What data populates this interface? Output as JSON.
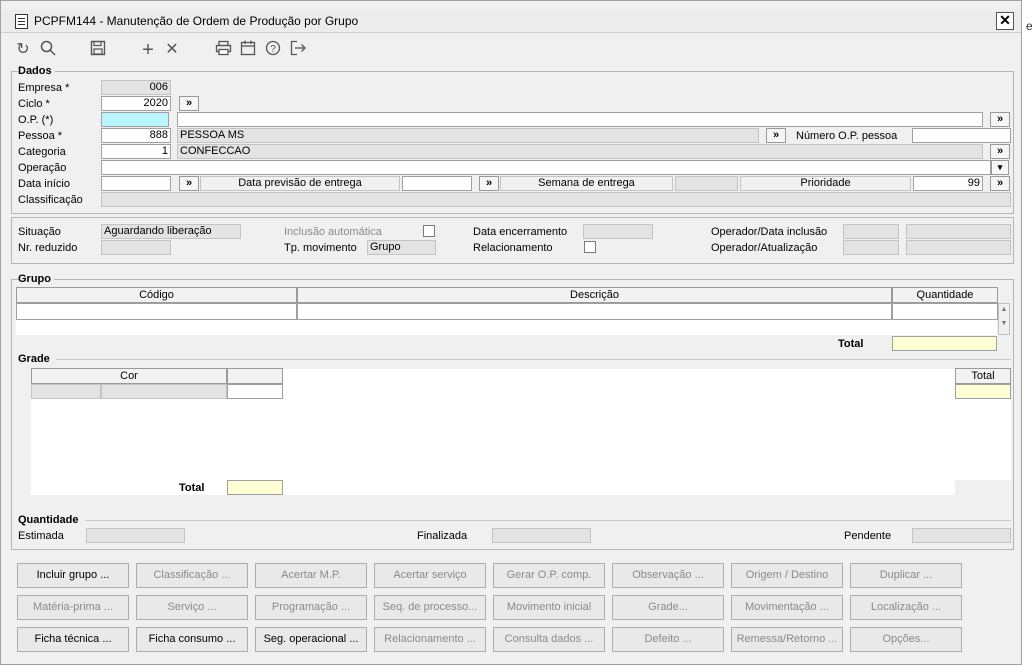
{
  "window": {
    "title": "PCPFM144 - Manutenção de Ordem de Produção por Grupo",
    "close_label": "✕",
    "behind_text": "e"
  },
  "toolbar": [
    {
      "name": "refresh-icon",
      "glyph": "↻"
    },
    {
      "name": "search-icon",
      "glyph": "🔍"
    },
    {
      "name": "save-icon",
      "glyph": "💾"
    },
    {
      "name": "add-icon",
      "glyph": "+"
    },
    {
      "name": "delete-icon",
      "glyph": "✕"
    },
    {
      "name": "print-icon",
      "glyph": "🖶"
    },
    {
      "name": "calendar-icon",
      "glyph": "📅"
    },
    {
      "name": "help-icon",
      "glyph": "?"
    },
    {
      "name": "exit-icon",
      "glyph": "⇥"
    }
  ],
  "dados": {
    "legend": "Dados",
    "empresa_label": "Empresa *",
    "empresa": "006",
    "ciclo_label": "Ciclo *",
    "ciclo": "2020",
    "op_label": "O.P. (*)",
    "op": "",
    "op_desc": "",
    "pessoa_label": "Pessoa *",
    "pessoa": "888",
    "pessoa_nome": "PESSOA MS",
    "numero_op_pessoa_label": "Número O.P. pessoa",
    "numero_op_pessoa": "",
    "categoria_label": "Categoria",
    "categoria": "1",
    "categoria_nome": "CONFECCAO",
    "operacao_label": "Operação",
    "operacao": "",
    "data_inicio_label": "Data início",
    "data_inicio": "",
    "data_previsao_label": "Data previsão de entrega",
    "data_previsao": "",
    "semana_label": "Semana de entrega",
    "semana": "",
    "prioridade_label": "Prioridade",
    "prioridade": "99",
    "classificacao_label": "Classificação",
    "classificacao": "",
    "arrow": "»",
    "dropdown": "▾"
  },
  "status": {
    "situacao_label": "Situação",
    "situacao": "Aguardando liberação",
    "nr_reduzido_label": "Nr. reduzido",
    "nr_reduzido": "",
    "inclusao_label": "Inclusão automática",
    "inclusao_checked": false,
    "tp_mov_label": "Tp. movimento",
    "tp_mov": "Grupo",
    "data_enc_label": "Data encerramento",
    "data_enc": "",
    "relacionamento_label": "Relacionamento",
    "relacionamento_checked": false,
    "op_inclusao_label": "Operador/Data inclusão",
    "op_inclusao_1": "",
    "op_inclusao_2": "",
    "op_atual_label": "Operador/Atualização",
    "op_atual_1": "",
    "op_atual_2": ""
  },
  "grupo": {
    "legend": "Grupo",
    "columns": [
      "Código",
      "Descrição",
      "Quantidade"
    ],
    "total_label": "Total",
    "total": ""
  },
  "grade": {
    "legend": "Grade",
    "cor_label": "Cor",
    "total_col_label": "Total",
    "total_label": "Total",
    "total": ""
  },
  "quantidade": {
    "legend": "Quantidade",
    "estimada_label": "Estimada",
    "estimada": "",
    "finalizada_label": "Finalizada",
    "finalizada": "",
    "pendente_label": "Pendente",
    "pendente": ""
  },
  "buttons": [
    {
      "label": "Incluir grupo ...",
      "enabled": true
    },
    {
      "label": "Classificação ...",
      "enabled": false
    },
    {
      "label": "Acertar M.P.",
      "enabled": false
    },
    {
      "label": "Acertar serviço",
      "enabled": false
    },
    {
      "label": "Gerar O.P. comp.",
      "enabled": false
    },
    {
      "label": "Observação ...",
      "enabled": false
    },
    {
      "label": "Origem / Destino",
      "enabled": false
    },
    {
      "label": "Duplicar ...",
      "enabled": false
    },
    {
      "label": "Matéria-prima ...",
      "enabled": false
    },
    {
      "label": "Serviço ...",
      "enabled": false
    },
    {
      "label": "Programação ...",
      "enabled": false
    },
    {
      "label": "Seq. de processo...",
      "enabled": false
    },
    {
      "label": "Movimento inicial",
      "enabled": false
    },
    {
      "label": "Grade...",
      "enabled": false
    },
    {
      "label": "Movimentação ...",
      "enabled": false
    },
    {
      "label": "Localização ...",
      "enabled": false
    },
    {
      "label": "Ficha técnica ...",
      "enabled": true
    },
    {
      "label": "Ficha consumo ...",
      "enabled": true
    },
    {
      "label": "Seg. operacional ...",
      "enabled": true
    },
    {
      "label": "Relacionamento ...",
      "enabled": false
    },
    {
      "label": "Consulta dados ...",
      "enabled": false
    },
    {
      "label": "Defeito ...",
      "enabled": false
    },
    {
      "label": "Remessa/Retorno ...",
      "enabled": false
    },
    {
      "label": "Opções...",
      "enabled": false
    }
  ]
}
